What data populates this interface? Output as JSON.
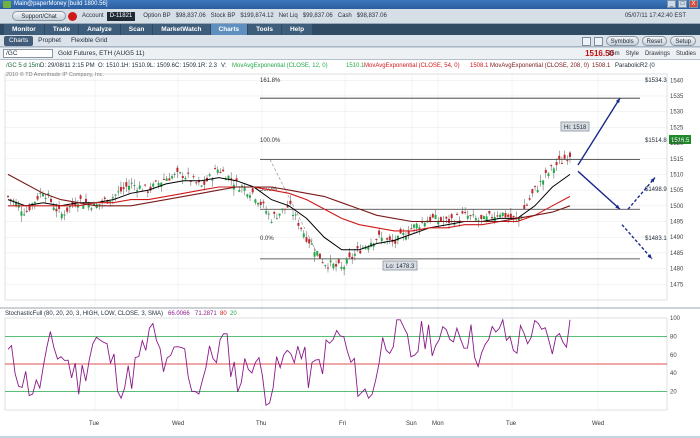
{
  "window": {
    "title": "Main@paperMoney [build 1800.56]",
    "buttons": [
      "_",
      "□",
      "X"
    ]
  },
  "account_bar": {
    "support_label": "Support/Chat",
    "account_label": "Account",
    "account_value": "D-11821",
    "option_bp_label": "Option BP",
    "option_bp": "$98,837.06",
    "stock_bp_label": "Stock BP",
    "stock_bp": "$199,874.12",
    "net_liq_label": "Net Liq",
    "net_liq": "$99,837.06",
    "cash_label": "Cash",
    "cash": "$98,837.06",
    "datetime": "05/07/11 17:42:40 EST"
  },
  "nav_tabs": [
    "Monitor",
    "Trade",
    "Analyze",
    "Scan",
    "MarketWatch",
    "Charts",
    "Tools",
    "Help"
  ],
  "active_nav_tab": "Charts",
  "sub_tabs": [
    "Charts",
    "Prophet",
    "Flexible Grid"
  ],
  "active_sub_tab": "Charts",
  "toolbar_right": {
    "symbols": "Symbols",
    "reset": "Reset",
    "setup": "Setup"
  },
  "symbol_bar": {
    "symbol": "/GC",
    "description": "Gold Futures, ETH (AUG5 11)",
    "price": "1516.50",
    "interval": "15m",
    "style": "Style",
    "drawings": "Drawings",
    "studies": "Studies"
  },
  "price_header": {
    "info": "/GC 5 d 15m",
    "date": "D: 29/08/11 2:15 PM",
    "o": "O: 1510.1",
    "h": "H: 1510.9",
    "l": "L: 1509.6",
    "c": "C: 1509.1",
    "r": "R: 2.3",
    "v": "V:",
    "ema12": "MovAvgExponential (CLOSE, 12, 0)",
    "ema12_val": "1510.1",
    "ema54": "MovAvgExponential (CLOSE, 54, 0)",
    "ema54_val": "1508.1",
    "ema208": "MovAvgExponential (CLOSE, 208, 0)",
    "ema208_val": "1508.1",
    "psar": "ParabolicR2 (0",
    "copyright": "2010 © TD Ameritrade IP Company, Inc."
  },
  "stoch_header": {
    "label": "StochasticFull (80, 20, 20, 3, HIGH, LOW, CLOSE, 3, SMA)",
    "v1": "66.0066",
    "v2": "71.2871",
    "v3": "80",
    "v4": "20"
  },
  "fib_labels": [
    "161.8%",
    "100.0%",
    "50.0%",
    "0.0%"
  ],
  "annotations": {
    "hi": "Hi: 1518",
    "lo": "Lo: 1478.3"
  },
  "target_labels": [
    "$1534.3",
    "$1514.8",
    "$1498.9",
    "$1483.1"
  ],
  "current_price_tag": "1516.5",
  "x_ticks": [
    "Tue",
    "Wed",
    "Thu",
    "Fri",
    "Sun",
    "Mon",
    "Tue",
    "Wed"
  ],
  "colors": {
    "ema12": "#23a84a",
    "ema54": "#d01818",
    "ema208": "#7a1a1a",
    "stoch": "#8a1a8a",
    "fib": "#303030"
  },
  "chart_data": [
    {
      "type": "line",
      "title": "",
      "ylim": [
        1470,
        1542
      ],
      "yticks": [
        1475,
        1480,
        1485,
        1490,
        1495,
        1500,
        1505,
        1510,
        1515,
        1520,
        1525,
        1530,
        1535,
        1540
      ],
      "x": [
        "Tue",
        "Wed",
        "Thu",
        "Fri",
        "Sun",
        "Mon",
        "Tue"
      ],
      "series": [
        {
          "name": "Close",
          "values": [
            1503,
            1498,
            1505,
            1497,
            1502,
            1500,
            1503,
            1507,
            1505,
            1509,
            1510,
            1506,
            1512,
            1507,
            1504,
            1496,
            1500,
            1490,
            1482,
            1480,
            1486,
            1490,
            1488,
            1493,
            1496,
            1495,
            1497,
            1495,
            1498,
            1495,
            1505,
            1512,
            1516.5
          ]
        },
        {
          "name": "MovAvgExponential (CLOSE, 12, 0)",
          "values": [
            1502,
            1500,
            1501,
            1500,
            1501,
            1501,
            1502,
            1504,
            1505,
            1507,
            1508,
            1508,
            1509,
            1508,
            1506,
            1502,
            1500,
            1496,
            1490,
            1486,
            1486,
            1488,
            1489,
            1491,
            1493,
            1494,
            1495,
            1495,
            1496,
            1496,
            1500,
            1506,
            1510
          ]
        },
        {
          "name": "MovAvgExponential (CLOSE, 54, 0)",
          "values": [
            1500,
            1500,
            1500,
            1500,
            1500,
            1501,
            1501,
            1502,
            1502,
            1503,
            1504,
            1505,
            1506,
            1506,
            1506,
            1505,
            1504,
            1502,
            1499,
            1496,
            1494,
            1493,
            1492,
            1492,
            1493,
            1493,
            1494,
            1494,
            1495,
            1495,
            1497,
            1500,
            1503
          ]
        },
        {
          "name": "MovAvgExponential (CLOSE, 208, 0)",
          "values": [
            1510,
            1507,
            1504,
            1502,
            1501,
            1500,
            1500,
            1500,
            1501,
            1502,
            1503,
            1504,
            1505,
            1506,
            1506,
            1506,
            1505,
            1504,
            1503,
            1501,
            1499,
            1497,
            1496,
            1495,
            1495,
            1495,
            1495,
            1495,
            1495,
            1496,
            1497,
            1498,
            1500
          ]
        }
      ]
    },
    {
      "type": "line",
      "title": "StochasticFull (80, 20, 20, 3, HIGH, LOW, CLOSE, 3, SMA)",
      "ylim": [
        0,
        100
      ],
      "yticks": [
        20,
        40,
        60,
        80,
        100
      ],
      "series": [
        {
          "name": "FullK",
          "values": [
            60,
            35,
            20,
            70,
            55,
            30,
            80,
            60,
            25,
            50,
            85,
            40,
            70,
            20,
            55,
            75,
            30,
            60,
            20,
            50,
            70,
            35,
            60,
            85,
            40,
            10,
            70,
            90,
            60,
            85,
            70,
            90,
            80,
            55,
            95,
            70,
            85,
            80,
            70,
            90
          ]
        }
      ]
    }
  ]
}
